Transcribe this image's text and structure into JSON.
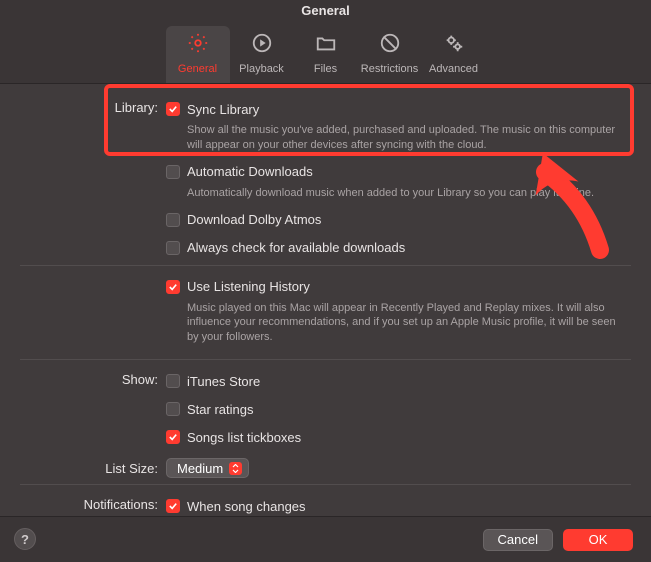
{
  "window": {
    "title": "General"
  },
  "tabs": {
    "general": "General",
    "playback": "Playback",
    "files": "Files",
    "restrictions": "Restrictions",
    "advanced": "Advanced"
  },
  "labels": {
    "library": "Library:",
    "show": "Show:",
    "list_size": "List Size:",
    "notifications": "Notifications:"
  },
  "library": {
    "sync": {
      "label": "Sync Library",
      "desc": "Show all the music you've added, purchased and uploaded. The music on this computer will appear on your other devices after syncing with the cloud."
    },
    "auto_dl": {
      "label": "Automatic Downloads",
      "desc": "Automatically download music when added to your Library so you can play it offline."
    },
    "dolby": {
      "label": "Download Dolby Atmos"
    },
    "avail": {
      "label": "Always check for available downloads"
    }
  },
  "history": {
    "label": "Use Listening History",
    "desc": "Music played on this Mac will appear in Recently Played and Replay mixes. It will also influence your recommendations, and if you set up an Apple Music profile, it will be seen by your followers."
  },
  "show": {
    "itunes": {
      "label": "iTunes Store"
    },
    "stars": {
      "label": "Star ratings"
    },
    "tickboxes": {
      "label": "Songs list tickboxes"
    }
  },
  "list_size": {
    "value": "Medium"
  },
  "notifications": {
    "song_changes": {
      "label": "When song changes"
    }
  },
  "footer": {
    "help": "?",
    "cancel": "Cancel",
    "ok": "OK"
  },
  "colors": {
    "accent": "#ff3b30",
    "bg": "#403b3c"
  }
}
